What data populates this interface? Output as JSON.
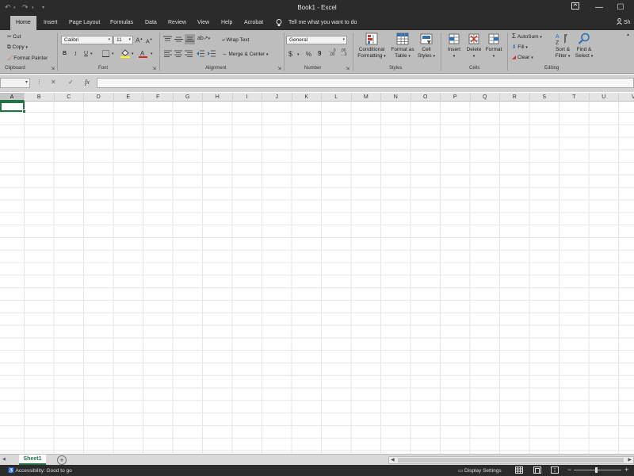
{
  "window": {
    "title": "Book1  -  Excel",
    "minimize": "—",
    "restore": "☐"
  },
  "quick_access": {
    "undo": "↶",
    "redo": "↷",
    "customize": "▾"
  },
  "tabs": [
    {
      "label": "Home",
      "active": true
    },
    {
      "label": "Insert"
    },
    {
      "label": "Page Layout"
    },
    {
      "label": "Formulas"
    },
    {
      "label": "Data"
    },
    {
      "label": "Review"
    },
    {
      "label": "View"
    },
    {
      "label": "Help"
    },
    {
      "label": "Acrobat"
    }
  ],
  "tell_me": "Tell me what you want to do",
  "share": "Sh",
  "ribbon": {
    "clipboard": {
      "cut": "Cut",
      "copy": "Copy",
      "format_painter": "Format Painter",
      "label": "Clipboard"
    },
    "font": {
      "family": "Calibri",
      "size": "11",
      "label": "Font",
      "bold": "B",
      "italic": "I",
      "underline": "U",
      "grow": "A",
      "shrink": "A"
    },
    "alignment": {
      "wrap": "Wrap Text",
      "merge": "Merge & Center",
      "label": "Alignment"
    },
    "number": {
      "format": "General",
      "currency": "$",
      "percent": "%",
      "comma": "9",
      "inc_dec": ".0 .00",
      "dec_dec": ".00 .0",
      "label": "Number"
    },
    "styles": {
      "conditional": [
        "Conditional",
        "Formatting"
      ],
      "table": [
        "Format as",
        "Table"
      ],
      "cell": [
        "Cell",
        "Styles"
      ],
      "label": "Styles"
    },
    "cells": {
      "insert": "Insert",
      "delete": "Delete",
      "format": "Format",
      "label": "Cells"
    },
    "editing": {
      "autosum": "AutoSum",
      "fill": "Fill",
      "clear": "Clear",
      "sort": [
        "Sort &",
        "Filter"
      ],
      "find": [
        "Find &",
        "Select"
      ],
      "label": "Editing"
    }
  },
  "formula_bar": {
    "cancel": "✕",
    "enter": "✓",
    "fx": "fx",
    "value": ""
  },
  "columns": [
    "A",
    "B",
    "C",
    "D",
    "E",
    "F",
    "G",
    "H",
    "I",
    "J",
    "K",
    "L",
    "M",
    "N",
    "O",
    "P",
    "Q",
    "R",
    "S",
    "T",
    "U",
    "V"
  ],
  "active_cell": "A1",
  "sheets": [
    {
      "name": "Sheet1",
      "active": true
    }
  ],
  "status": {
    "accessibility": "Accessibility: Good to go",
    "display_settings": "Display Settings"
  },
  "colors": {
    "accent": "#217346",
    "titlebar": "#2b2b2b",
    "ribbon": "#bdbdbd"
  }
}
